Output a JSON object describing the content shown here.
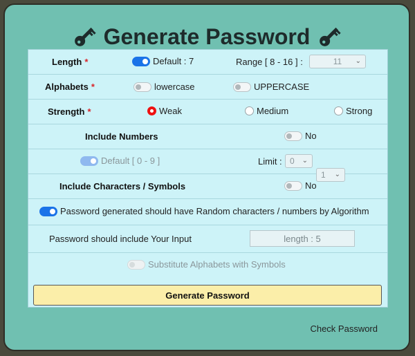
{
  "title": "Generate Password",
  "length": {
    "label": "Length",
    "required": "*",
    "default_text": "Default : 7",
    "range_label": "Range [ 8 - 16 ] :",
    "range_value": "11"
  },
  "alphabets": {
    "label": "Alphabets",
    "required": "*",
    "lowercase": "lowercase",
    "uppercase": "UPPERCASE"
  },
  "strength": {
    "label": "Strength",
    "required": "*",
    "options": [
      "Weak",
      "Medium",
      "Strong"
    ],
    "selected": "Weak"
  },
  "numbers": {
    "label": "Include Numbers",
    "toggle_text": "No",
    "default_text": "Default [ 0 - 9 ]",
    "limit_label": "Limit :",
    "limit_from": "0",
    "limit_to": "1"
  },
  "symbols": {
    "label": "Include Characters / Symbols",
    "toggle_text": "No"
  },
  "random": {
    "text": "Password generated should have Random characters / numbers by Algorithm"
  },
  "user_input": {
    "label": "Password should include Your Input",
    "placeholder": "length : 5"
  },
  "substitute": {
    "text": "Substitute Alphabets with Symbols"
  },
  "generate_button": "Generate Password",
  "check_link": "Check Password",
  "colors": {
    "background": "#70c0b1",
    "panel": "#cdf3f8",
    "toggle_on": "#1a73e8",
    "required": "#d9252a",
    "button": "#fbeea9"
  }
}
